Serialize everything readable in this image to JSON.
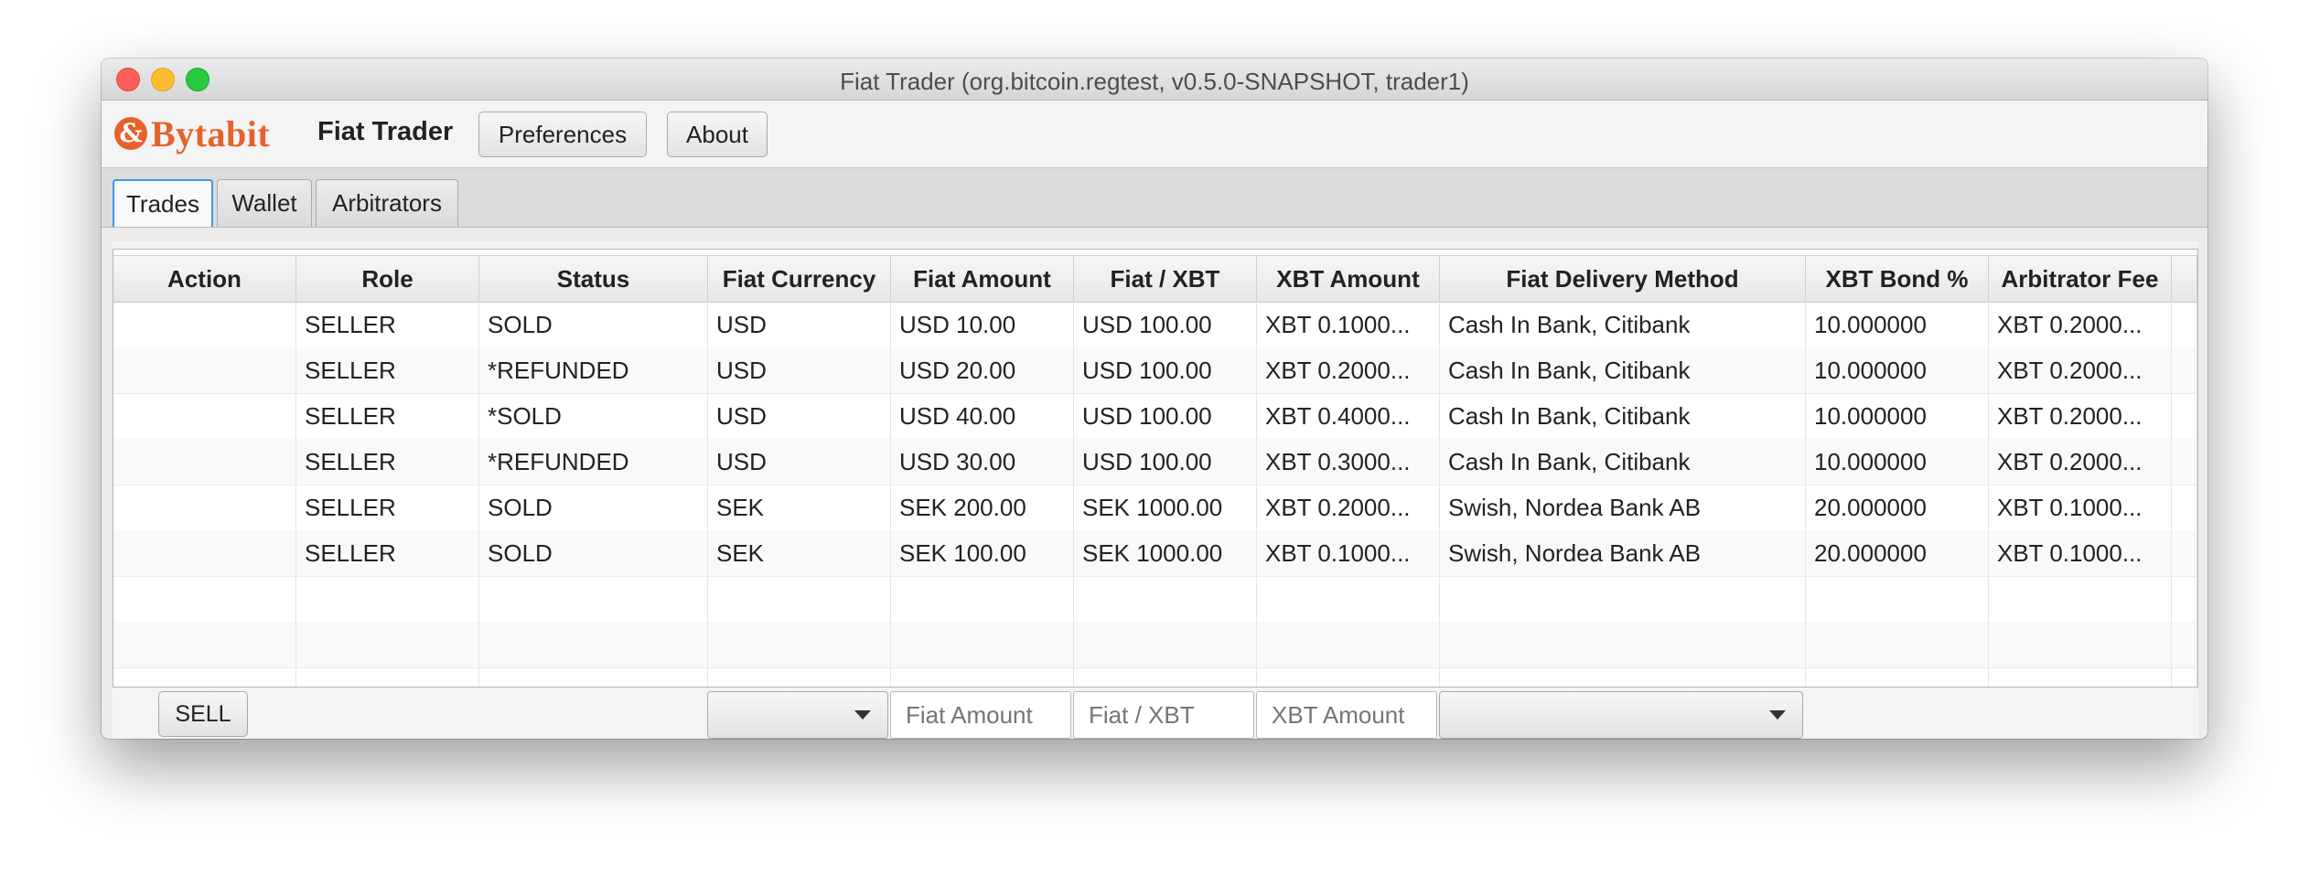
{
  "window": {
    "title": "Fiat Trader (org.bitcoin.regtest, v0.5.0-SNAPSHOT, trader1)"
  },
  "toolbar": {
    "logo_mark": "&",
    "logo_text": "Bytabit",
    "app_name": "Fiat Trader",
    "preferences_label": "Preferences",
    "about_label": "About"
  },
  "tabs": [
    {
      "label": "Trades",
      "active": true
    },
    {
      "label": "Wallet",
      "active": false
    },
    {
      "label": "Arbitrators",
      "active": false
    }
  ],
  "table": {
    "columns": [
      "Action",
      "Role",
      "Status",
      "Fiat Currency",
      "Fiat Amount",
      "Fiat / XBT",
      "XBT Amount",
      "Fiat Delivery Method",
      "XBT Bond %",
      "Arbitrator Fee"
    ],
    "rows": [
      [
        "",
        "SELLER",
        "SOLD",
        "USD",
        "USD 10.00",
        "USD 100.00",
        "XBT 0.1000...",
        "Cash In Bank, Citibank",
        "10.000000",
        "XBT 0.2000..."
      ],
      [
        "",
        "SELLER",
        "*REFUNDED",
        "USD",
        "USD 20.00",
        "USD 100.00",
        "XBT 0.2000...",
        "Cash In Bank, Citibank",
        "10.000000",
        "XBT 0.2000..."
      ],
      [
        "",
        "SELLER",
        "*SOLD",
        "USD",
        "USD 40.00",
        "USD 100.00",
        "XBT 0.4000...",
        "Cash In Bank, Citibank",
        "10.000000",
        "XBT 0.2000..."
      ],
      [
        "",
        "SELLER",
        "*REFUNDED",
        "USD",
        "USD 30.00",
        "USD 100.00",
        "XBT 0.3000...",
        "Cash In Bank, Citibank",
        "10.000000",
        "XBT 0.2000..."
      ],
      [
        "",
        "SELLER",
        "SOLD",
        "SEK",
        "SEK 200.00",
        "SEK 1000.00",
        "XBT 0.2000...",
        "Swish, Nordea Bank AB",
        "20.000000",
        "XBT 0.1000..."
      ],
      [
        "",
        "SELLER",
        "SOLD",
        "SEK",
        "SEK 100.00",
        "SEK 1000.00",
        "XBT 0.1000...",
        "Swish, Nordea Bank AB",
        "20.000000",
        "XBT 0.1000..."
      ],
      [
        "",
        "",
        "",
        "",
        "",
        "",
        "",
        "",
        "",
        ""
      ],
      [
        "",
        "",
        "",
        "",
        "",
        "",
        "",
        "",
        "",
        ""
      ],
      [
        "",
        "",
        "",
        "",
        "",
        "",
        "",
        "",
        "",
        ""
      ]
    ]
  },
  "form": {
    "sell_label": "SELL",
    "currency_value": "",
    "fiat_amount_placeholder": "Fiat Amount",
    "fiat_rate_placeholder": "Fiat / XBT",
    "xbt_amount_placeholder": "XBT Amount",
    "method_value": ""
  }
}
